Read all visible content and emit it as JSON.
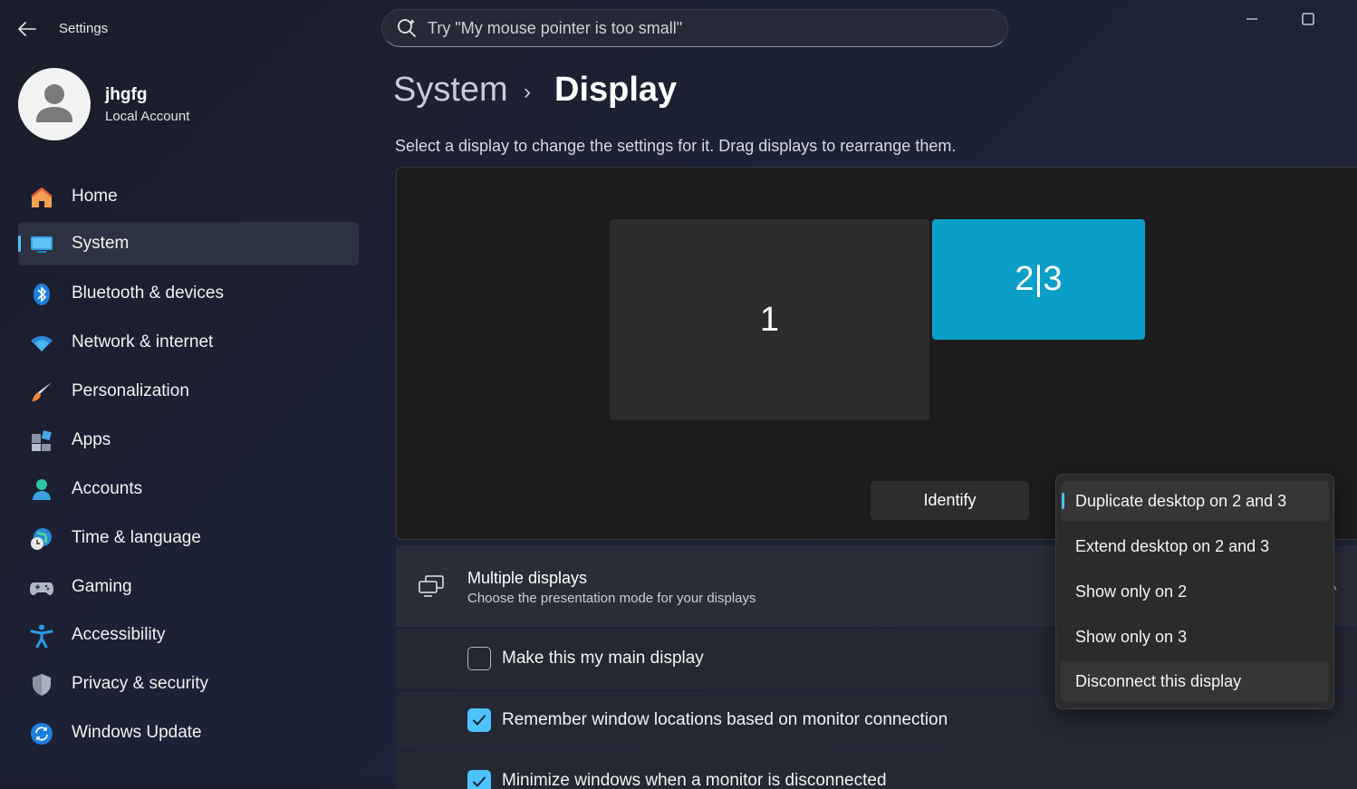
{
  "window": {
    "title": "Settings"
  },
  "search": {
    "placeholder": "Try \"My mouse pointer is too small\""
  },
  "user": {
    "name": "jhgfg",
    "account_type": "Local Account"
  },
  "sidebar": {
    "items": [
      {
        "label": "Home",
        "icon": "home-icon"
      },
      {
        "label": "System",
        "icon": "system-icon",
        "selected": true
      },
      {
        "label": "Bluetooth & devices",
        "icon": "bluetooth-icon"
      },
      {
        "label": "Network & internet",
        "icon": "wifi-icon"
      },
      {
        "label": "Personalization",
        "icon": "brush-icon"
      },
      {
        "label": "Apps",
        "icon": "apps-icon"
      },
      {
        "label": "Accounts",
        "icon": "accounts-icon"
      },
      {
        "label": "Time & language",
        "icon": "globe-clock-icon"
      },
      {
        "label": "Gaming",
        "icon": "gamepad-icon"
      },
      {
        "label": "Accessibility",
        "icon": "accessibility-icon"
      },
      {
        "label": "Privacy & security",
        "icon": "shield-icon"
      },
      {
        "label": "Windows Update",
        "icon": "update-icon"
      }
    ]
  },
  "breadcrumb": {
    "parent": "System",
    "separator": "›",
    "current": "Display"
  },
  "display_page": {
    "description": "Select a display to change the settings for it. Drag displays to rearrange them.",
    "monitors": [
      {
        "label": "1"
      },
      {
        "label": "2|3"
      }
    ],
    "identify_label": "Identify"
  },
  "multiple_displays": {
    "title": "Multiple displays",
    "subtitle": "Choose the presentation mode for your displays",
    "options": [
      {
        "label": "Make this my main display",
        "checked": false
      },
      {
        "label": "Remember window locations based on monitor connection",
        "checked": true
      },
      {
        "label": "Minimize windows when a monitor is disconnected",
        "checked": true
      }
    ]
  },
  "mode_menu": {
    "items": [
      {
        "label": "Duplicate desktop on 2 and 3",
        "selected": true
      },
      {
        "label": "Extend desktop on 2 and 3"
      },
      {
        "label": "Show only on 2"
      },
      {
        "label": "Show only on 3"
      },
      {
        "label": "Disconnect this display",
        "hovered": true
      }
    ]
  },
  "colors": {
    "accent": "#4cc2ff",
    "monitor_selected": "#0b9ec6"
  }
}
